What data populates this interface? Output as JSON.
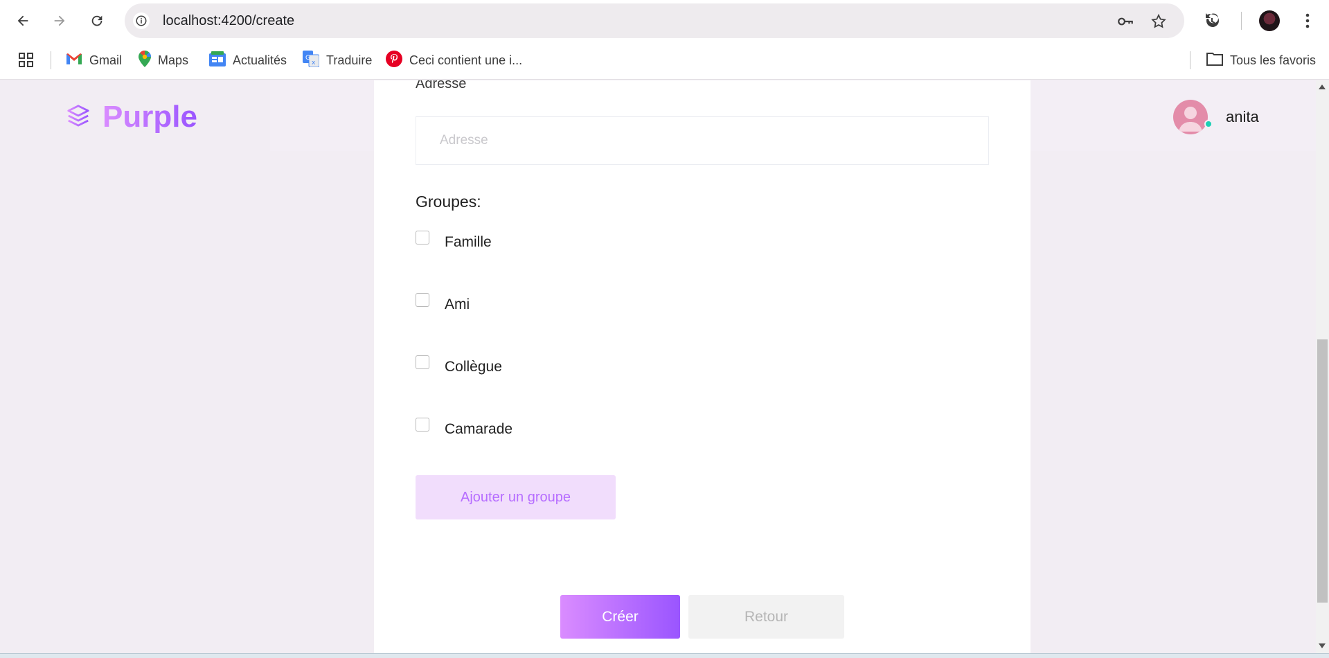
{
  "browser": {
    "url_host": "localhost",
    "url_path": ":4200/create",
    "bookmarks": [
      {
        "label": "Gmail",
        "icon": "gmail-icon"
      },
      {
        "label": "Maps",
        "icon": "maps-icon"
      },
      {
        "label": "Actualités",
        "icon": "news-icon"
      },
      {
        "label": "Traduire",
        "icon": "translate-icon"
      },
      {
        "label": "Ceci contient une i...",
        "icon": "pinterest-icon"
      }
    ],
    "all_bookmarks_label": "Tous les favoris"
  },
  "navbar": {
    "brand": "Purple",
    "user_name": "anita"
  },
  "form": {
    "address_label": "Adresse",
    "address_placeholder": "Adresse",
    "address_value": "",
    "groups_title": "Groupes:",
    "groups": [
      {
        "label": "Famille",
        "checked": false
      },
      {
        "label": "Ami",
        "checked": false
      },
      {
        "label": "Collègue",
        "checked": false
      },
      {
        "label": "Camarade",
        "checked": false
      }
    ],
    "add_group_label": "Ajouter un groupe",
    "create_label": "Créer",
    "back_label": "Retour"
  },
  "colors": {
    "accent": "#b66dff",
    "gradient_start": "#da8cff",
    "gradient_end": "#9a55ff",
    "online": "#1bcfb4"
  }
}
